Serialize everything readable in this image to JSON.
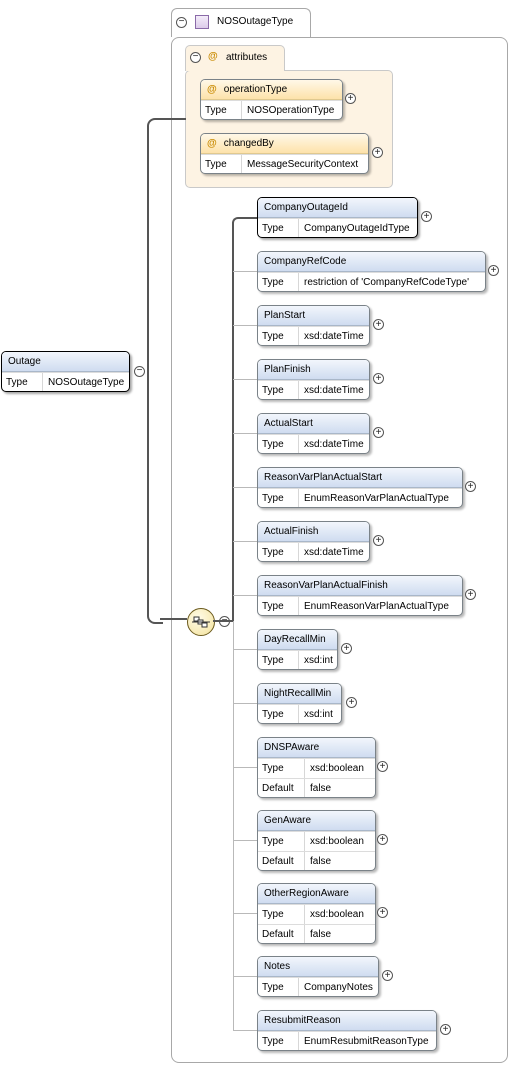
{
  "root": {
    "name": "Outage",
    "type_label": "Type",
    "type": "NOSOutageType"
  },
  "complex_type": {
    "name": "NOSOutageType"
  },
  "attributes_group": {
    "label": "attributes",
    "items": [
      {
        "name": "operationType",
        "type_label": "Type",
        "type": "NOSOperationType"
      },
      {
        "name": "changedBy",
        "type_label": "Type",
        "type": "MessageSecurityContext"
      }
    ]
  },
  "elements": [
    {
      "name": "CompanyOutageId",
      "type_label": "Type",
      "type": "CompanyOutageIdType"
    },
    {
      "name": "CompanyRefCode",
      "type_label": "Type",
      "type": "restriction of 'CompanyRefCodeType'"
    },
    {
      "name": "PlanStart",
      "type_label": "Type",
      "type": "xsd:dateTime"
    },
    {
      "name": "PlanFinish",
      "type_label": "Type",
      "type": "xsd:dateTime"
    },
    {
      "name": "ActualStart",
      "type_label": "Type",
      "type": "xsd:dateTime"
    },
    {
      "name": "ReasonVarPlanActualStart",
      "type_label": "Type",
      "type": "EnumReasonVarPlanActualType"
    },
    {
      "name": "ActualFinish",
      "type_label": "Type",
      "type": "xsd:dateTime"
    },
    {
      "name": "ReasonVarPlanActualFinish",
      "type_label": "Type",
      "type": "EnumReasonVarPlanActualType"
    },
    {
      "name": "DayRecallMin",
      "type_label": "Type",
      "type": "xsd:int"
    },
    {
      "name": "NightRecallMin",
      "type_label": "Type",
      "type": "xsd:int"
    },
    {
      "name": "DNSPAware",
      "type_label": "Type",
      "type": "xsd:boolean",
      "default_label": "Default",
      "default": "false"
    },
    {
      "name": "GenAware",
      "type_label": "Type",
      "type": "xsd:boolean",
      "default_label": "Default",
      "default": "false"
    },
    {
      "name": "OtherRegionAware",
      "type_label": "Type",
      "type": "xsd:boolean",
      "default_label": "Default",
      "default": "false"
    },
    {
      "name": "Notes",
      "type_label": "Type",
      "type": "CompanyNotes"
    },
    {
      "name": "ResubmitReason",
      "type_label": "Type",
      "type": "EnumResubmitReasonType"
    }
  ],
  "glyphs": {
    "expand": "+",
    "collapse": "−",
    "attribute": "@"
  },
  "colors": {
    "element_header": "#cfdcf0",
    "attribute_header": "#fde2aa",
    "attribute_panel": "#fdf3e3",
    "connector": "#555555"
  }
}
